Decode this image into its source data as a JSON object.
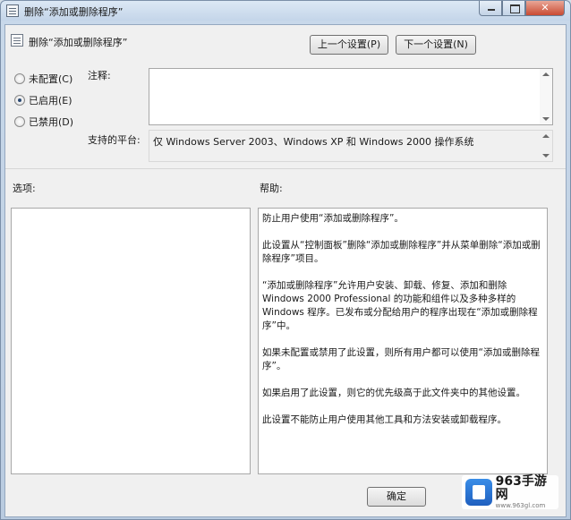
{
  "window": {
    "title": "删除“添加或删除程序”",
    "policy_title": "删除“添加或删除程序”"
  },
  "nav": {
    "prev_label": "上一个设置(P)",
    "next_label": "下一个设置(N)"
  },
  "state": {
    "options": [
      {
        "label": "未配置(C)",
        "checked": false
      },
      {
        "label": "已启用(E)",
        "checked": true
      },
      {
        "label": "已禁用(D)",
        "checked": false
      }
    ]
  },
  "comment": {
    "label": "注释:",
    "value": ""
  },
  "platform": {
    "label": "支持的平台:",
    "value": "仅 Windows Server 2003、Windows XP 和 Windows 2000 操作系统"
  },
  "options_pane": {
    "label": "选项:"
  },
  "help_pane": {
    "label": "帮助:",
    "paragraphs": [
      "防止用户使用“添加或删除程序”。",
      "此设置从“控制面板”删除“添加或删除程序”并从菜单删除“添加或删除程序”项目。",
      "“添加或删除程序”允许用户安装、卸载、修复、添加和删除 Windows 2000 Professional 的功能和组件以及多种多样的 Windows 程序。已发布或分配给用户的程序出现在“添加或删除程序”中。",
      "如果未配置或禁用了此设置，则所有用户都可以使用“添加或删除程序”。",
      "如果启用了此设置，则它的优先级高于此文件夹中的其他设置。",
      "此设置不能防止用户使用其他工具和方法安装或卸载程序。"
    ]
  },
  "footer": {
    "ok_label": "确定"
  },
  "watermark": {
    "name": "963手游网",
    "url": "www.963gl.com"
  }
}
